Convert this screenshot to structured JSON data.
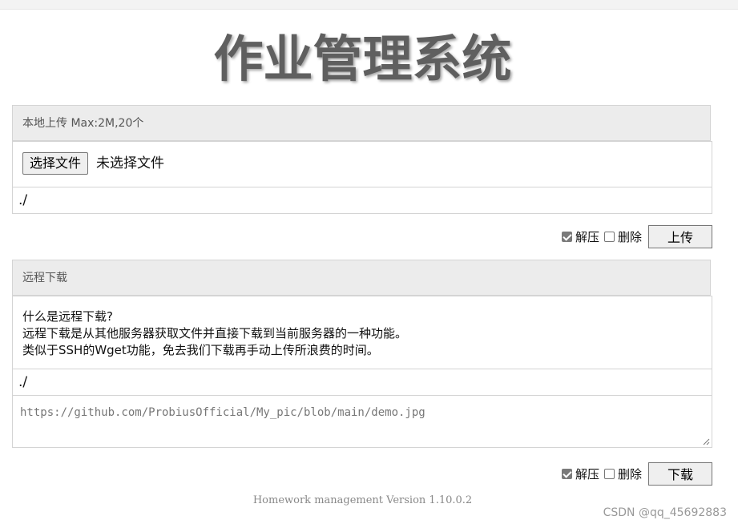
{
  "page": {
    "title": "作业管理系统"
  },
  "local_upload": {
    "header": "本地上传 Max:2M,20个",
    "choose_file_label": "选择文件",
    "file_status": "未选择文件",
    "path_value": "./",
    "options": {
      "extract_label": "解压",
      "extract_checked": true,
      "delete_label": "删除",
      "delete_checked": false
    },
    "submit_label": "上传"
  },
  "remote_download": {
    "header": "远程下载",
    "description": {
      "line1": "什么是远程下载?",
      "line2": "远程下载是从其他服务器获取文件并直接下载到当前服务器的一种功能。",
      "line3": "类似于SSH的Wget功能，免去我们下载再手动上传所浪费的时间。"
    },
    "path_value": "./",
    "url_placeholder": "https://github.com/ProbiusOfficial/My_pic/blob/main/demo.jpg",
    "options": {
      "extract_label": "解压",
      "extract_checked": true,
      "delete_label": "删除",
      "delete_checked": false
    },
    "submit_label": "下载"
  },
  "footer": {
    "version_text": "Homework management Version 1.10.0.2"
  },
  "watermark": "CSDN @qq_45692883"
}
